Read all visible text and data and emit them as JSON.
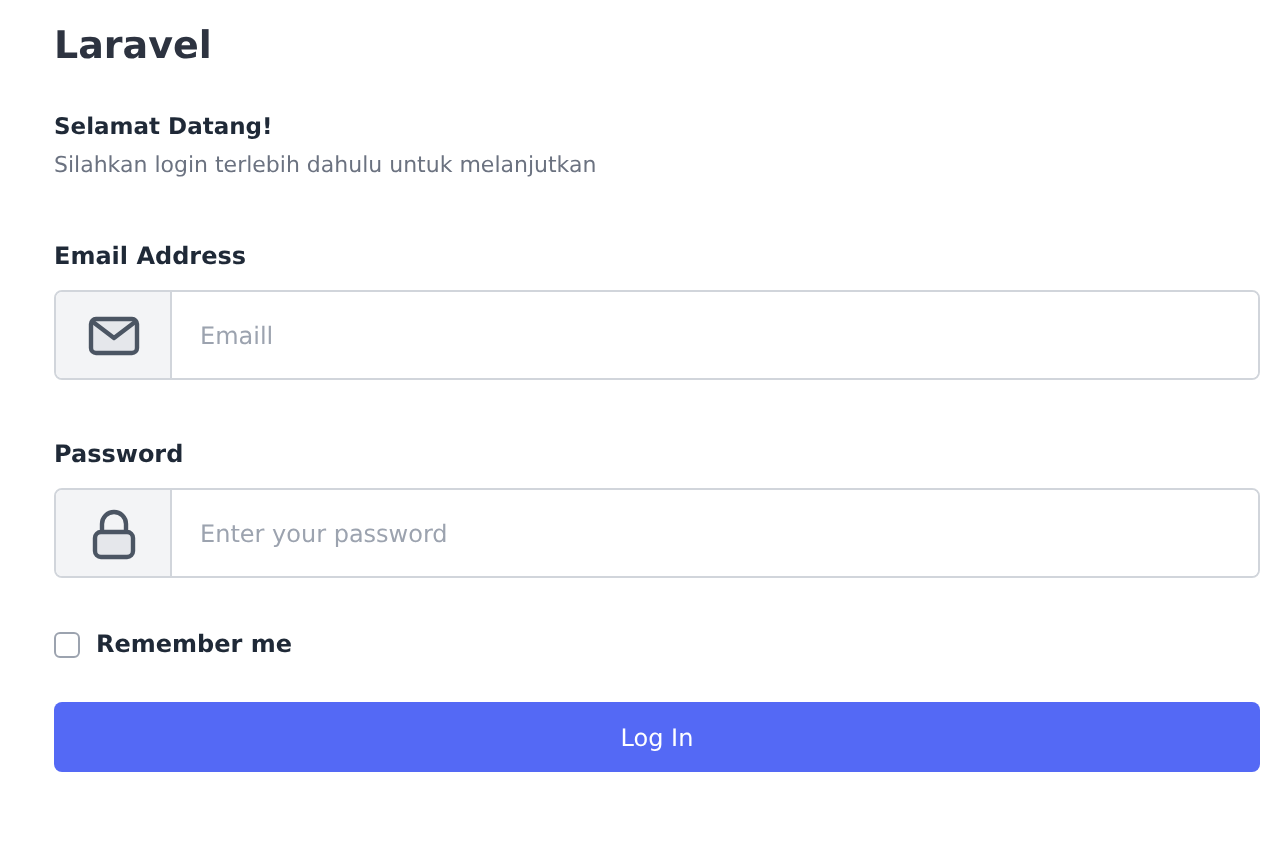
{
  "brand": "Laravel",
  "greeting": "Selamat Datang!",
  "subtitle": "Silahkan login terlebih dahulu untuk melanjutkan",
  "fields": [
    {
      "kind": "email",
      "label": "Email Address",
      "placeholder": "Emaill"
    },
    {
      "kind": "password",
      "label": "Password",
      "placeholder": "Enter your password"
    }
  ],
  "remember": {
    "label": "Remember me",
    "checked": false
  },
  "submit": "Log In"
}
